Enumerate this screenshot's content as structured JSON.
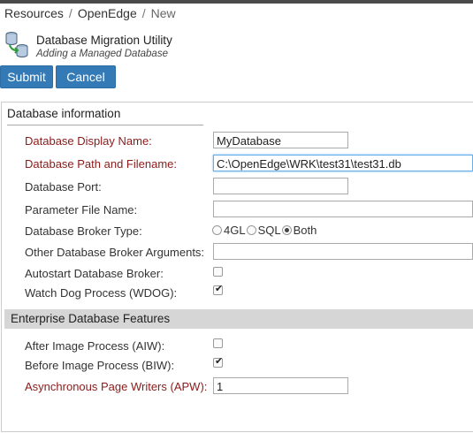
{
  "breadcrumb": {
    "items": [
      "Resources",
      "OpenEdge"
    ],
    "current": "New",
    "separator": "/"
  },
  "header": {
    "title": "Database Migration Utility",
    "subtitle": "Adding a Managed Database"
  },
  "buttons": {
    "submit": "Submit",
    "cancel": "Cancel"
  },
  "section_db": {
    "legend": "Database information",
    "fields": {
      "display_name": {
        "label": "Database Display Name:",
        "value": "MyDatabase"
      },
      "path": {
        "label": "Database Path and Filename:",
        "value": "C:\\OpenEdge\\WRK\\test31\\test31.db"
      },
      "port": {
        "label": "Database Port:",
        "value": ""
      },
      "param_file": {
        "label": "Parameter File Name:",
        "value": ""
      },
      "broker_type": {
        "label": "Database Broker Type:",
        "options": [
          "4GL",
          "SQL",
          "Both"
        ],
        "selected": "Both"
      },
      "broker_args": {
        "label": "Other Database Broker Arguments:",
        "value": ""
      },
      "autostart": {
        "label": "Autostart Database Broker:",
        "checked": false
      },
      "wdog": {
        "label": "Watch Dog Process (WDOG):",
        "checked": true
      }
    }
  },
  "section_enterprise": {
    "title": "Enterprise Database Features",
    "fields": {
      "aiw": {
        "label": "After Image Process (AIW):",
        "checked": false
      },
      "biw": {
        "label": "Before Image Process (BIW):",
        "checked": true
      },
      "apw": {
        "label": "Asynchronous Page Writers (APW):",
        "value": "1"
      }
    }
  },
  "colors": {
    "accent": "#337ab7",
    "required_label": "#8b1a1a",
    "section_bar": "#d6d6d6"
  },
  "icons": {
    "header": "database-migration-icon"
  }
}
